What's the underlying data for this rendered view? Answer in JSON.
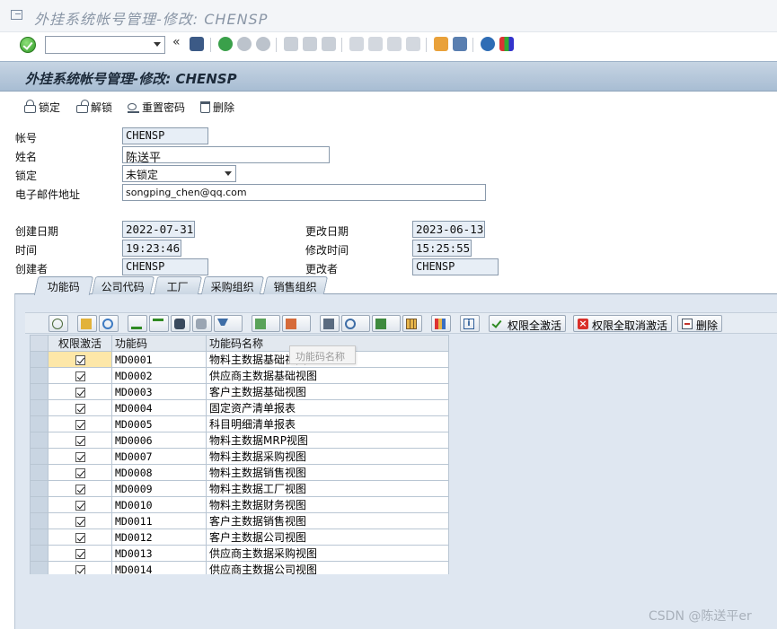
{
  "window": {
    "title": "外挂系统帐号管理-修改: CHENSP"
  },
  "system_toolbar": {
    "command_value": "",
    "icons": [
      "enter-icon",
      "save-icon",
      "back-icon",
      "exit-icon",
      "cancel-icon",
      "print-icon",
      "find-icon",
      "find-next-icon",
      "first-page-icon",
      "previous-page-icon",
      "next-page-icon",
      "last-page-icon",
      "new-session-icon",
      "shortcut-icon",
      "help-icon",
      "customize-layout-icon"
    ]
  },
  "header": {
    "screen_title": "外挂系统帐号管理-修改: CHENSP"
  },
  "app_toolbar": {
    "lock_label": "锁定",
    "unlock_label": "解锁",
    "reset_pwd_label": "重置密码",
    "delete_label": "删除"
  },
  "form": {
    "account_label": "帐号",
    "account_value": "CHENSP",
    "name_label": "姓名",
    "name_value": "陈送平",
    "lock_label": "锁定",
    "lock_value": "未锁定",
    "email_label": "电子邮件地址",
    "email_value": "songping_chen@qq.com",
    "created_date_label": "创建日期",
    "created_date_value": "2022-07-31",
    "changed_date_label": "更改日期",
    "changed_date_value": "2023-06-13",
    "time_label": "时间",
    "time_value": "19:23:46",
    "changed_time_label": "修改时间",
    "changed_time_value": "15:25:55",
    "creator_label": "创建者",
    "creator_value": "CHENSP",
    "changer_label": "更改者",
    "changer_value": "CHENSP"
  },
  "tabs": [
    {
      "label": "功能码",
      "active": true
    },
    {
      "label": "公司代码",
      "active": false
    },
    {
      "label": "工厂",
      "active": false
    },
    {
      "label": "采购组织",
      "active": false
    },
    {
      "label": "销售组织",
      "active": false
    }
  ],
  "alv_toolbar": {
    "activate_all_label": "权限全激活",
    "deactivate_all_label": "权限全取消激活",
    "delete_label": "删除"
  },
  "grid": {
    "columns": {
      "sel": "",
      "active": "权限激活",
      "code": "功能码",
      "name": "功能码名称"
    },
    "tooltip": "功能码名称",
    "rows": [
      {
        "active": true,
        "code": "MD0001",
        "name": "物料主数据基础视图"
      },
      {
        "active": true,
        "code": "MD0002",
        "name": "供应商主数据基础视图"
      },
      {
        "active": true,
        "code": "MD0003",
        "name": "客户主数据基础视图"
      },
      {
        "active": true,
        "code": "MD0004",
        "name": "固定资产清单报表"
      },
      {
        "active": true,
        "code": "MD0005",
        "name": "科目明细清单报表"
      },
      {
        "active": true,
        "code": "MD0006",
        "name": "物料主数据MRP视图"
      },
      {
        "active": true,
        "code": "MD0007",
        "name": "物料主数据采购视图"
      },
      {
        "active": true,
        "code": "MD0008",
        "name": "物料主数据销售视图"
      },
      {
        "active": true,
        "code": "MD0009",
        "name": "物料主数据工厂视图"
      },
      {
        "active": true,
        "code": "MD0010",
        "name": "物料主数据财务视图"
      },
      {
        "active": true,
        "code": "MD0011",
        "name": "客户主数据销售视图"
      },
      {
        "active": true,
        "code": "MD0012",
        "name": "客户主数据公司视图"
      },
      {
        "active": true,
        "code": "MD0013",
        "name": "供应商主数据采购视图"
      },
      {
        "active": true,
        "code": "MD0014",
        "name": "供应商主数据公司视图"
      }
    ]
  },
  "watermark": "CSDN @陈送平er"
}
